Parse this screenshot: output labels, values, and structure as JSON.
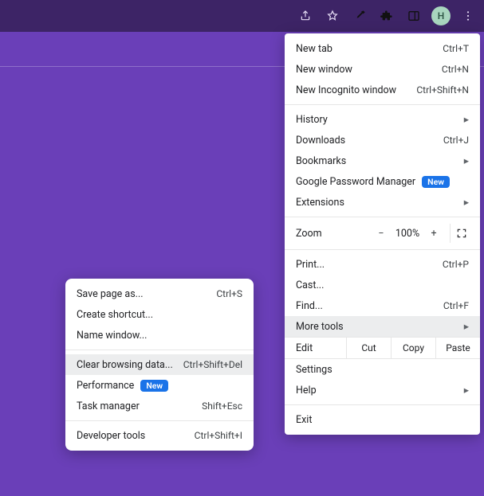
{
  "topbar": {
    "avatar_initial": "H"
  },
  "main_menu": {
    "new_tab": {
      "label": "New tab",
      "shortcut": "Ctrl+T"
    },
    "new_window": {
      "label": "New window",
      "shortcut": "Ctrl+N"
    },
    "new_incognito": {
      "label": "New Incognito window",
      "shortcut": "Ctrl+Shift+N"
    },
    "history": {
      "label": "History"
    },
    "downloads": {
      "label": "Downloads",
      "shortcut": "Ctrl+J"
    },
    "bookmarks": {
      "label": "Bookmarks"
    },
    "password_mgr": {
      "label": "Google Password Manager",
      "badge": "New"
    },
    "extensions": {
      "label": "Extensions"
    },
    "zoom": {
      "label": "Zoom",
      "minus": "−",
      "value": "100%",
      "plus": "+"
    },
    "print": {
      "label": "Print...",
      "shortcut": "Ctrl+P"
    },
    "cast": {
      "label": "Cast..."
    },
    "find": {
      "label": "Find...",
      "shortcut": "Ctrl+F"
    },
    "more_tools": {
      "label": "More tools"
    },
    "edit": {
      "label": "Edit",
      "cut": "Cut",
      "copy": "Copy",
      "paste": "Paste"
    },
    "settings": {
      "label": "Settings"
    },
    "help": {
      "label": "Help"
    },
    "exit": {
      "label": "Exit"
    }
  },
  "sub_menu": {
    "save_page": {
      "label": "Save page as...",
      "shortcut": "Ctrl+S"
    },
    "create_shortcut": {
      "label": "Create shortcut..."
    },
    "name_window": {
      "label": "Name window..."
    },
    "clear_browsing": {
      "label": "Clear browsing data...",
      "shortcut": "Ctrl+Shift+Del"
    },
    "performance": {
      "label": "Performance",
      "badge": "New"
    },
    "task_manager": {
      "label": "Task manager",
      "shortcut": "Shift+Esc"
    },
    "developer_tools": {
      "label": "Developer tools",
      "shortcut": "Ctrl+Shift+I"
    }
  }
}
